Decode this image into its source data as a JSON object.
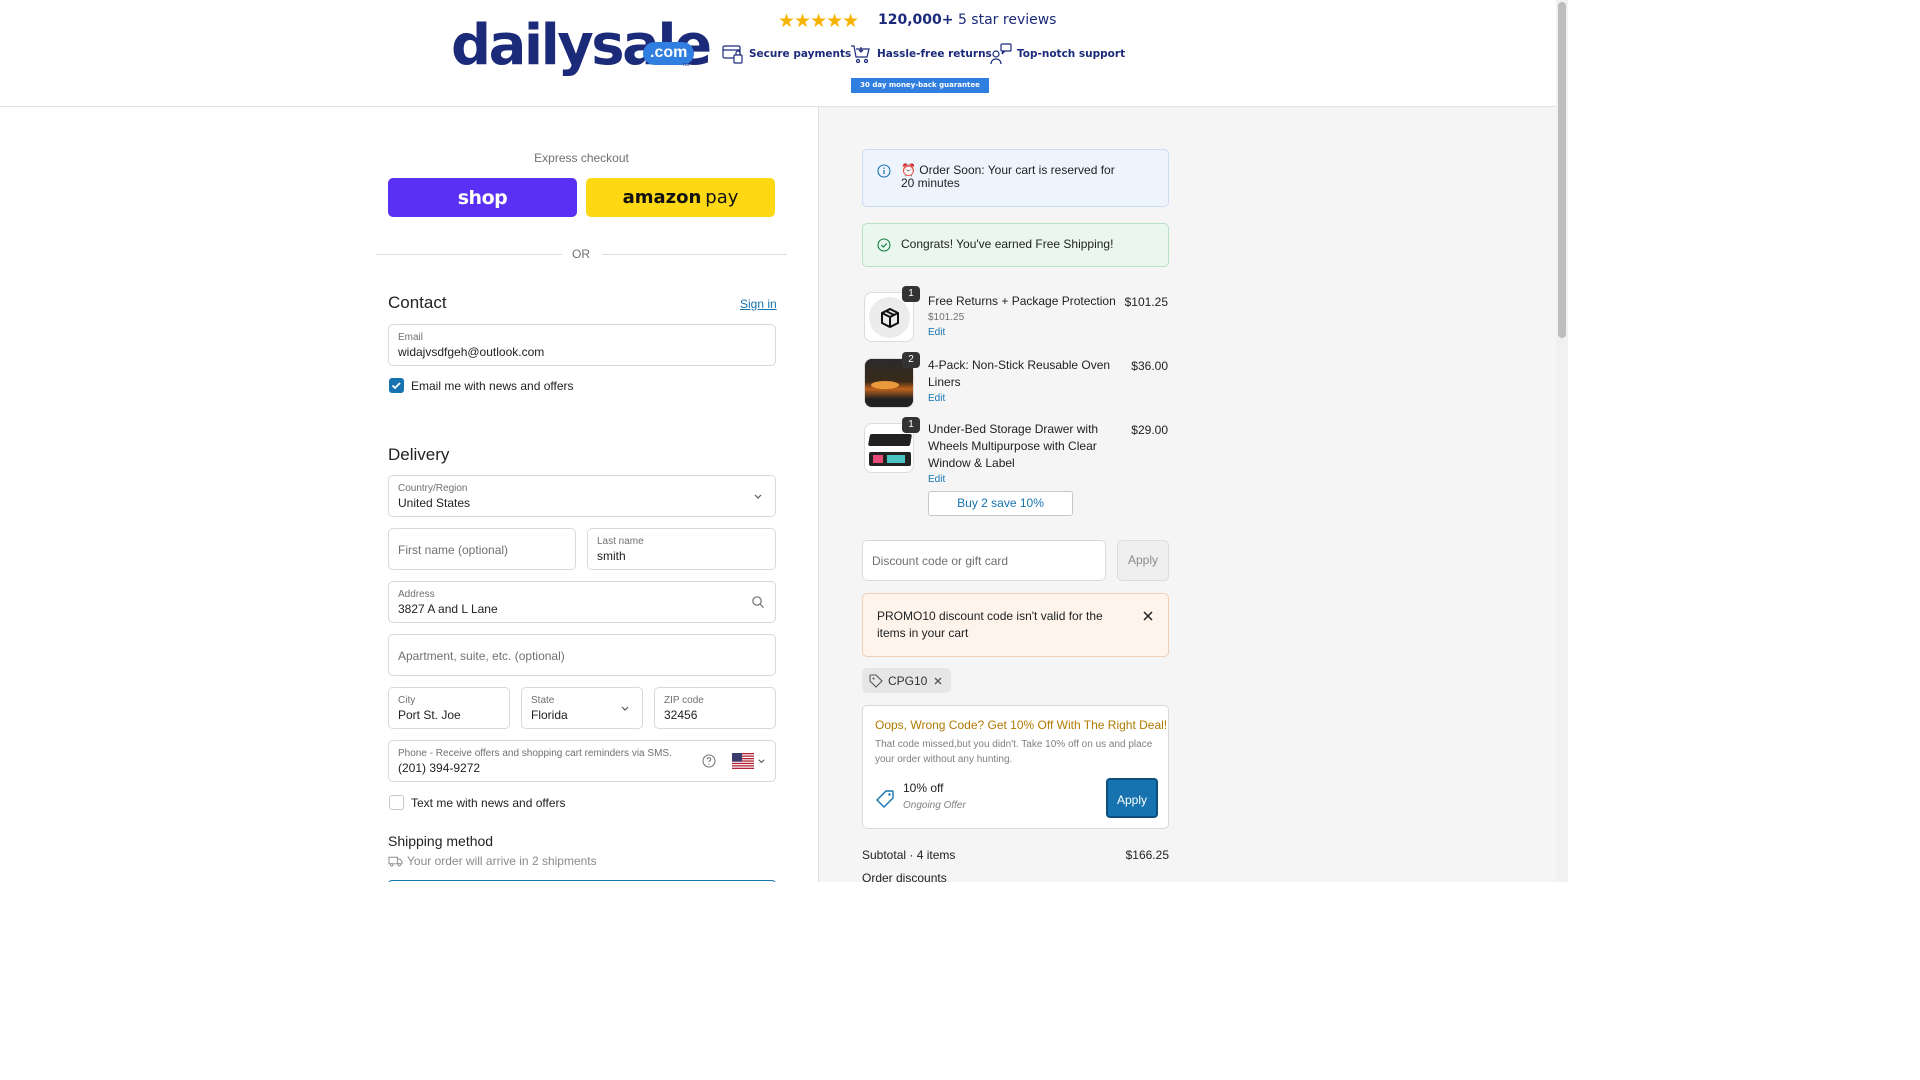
{
  "header": {
    "logo_text": "dailysale",
    "logo_suffix": ".com",
    "logo_tm": "™",
    "stars": "★★★★★",
    "reviews_count": "120,000+",
    "reviews_label": " 5 star reviews",
    "features": [
      {
        "label": "Secure payments",
        "icon": "secure-payment-icon"
      },
      {
        "label": "Hassle-free returns",
        "icon": "cart-return-icon"
      },
      {
        "label": "Top-notch support",
        "icon": "support-agent-icon"
      }
    ],
    "guarantee": "30 day money-back guarantee"
  },
  "express": {
    "label": "Express checkout",
    "shop_label": "shop",
    "amazon_label": "amazon",
    "amazon_pay": "pay",
    "or": "OR"
  },
  "contact": {
    "title": "Contact",
    "sign_in": "Sign in",
    "email_label": "Email",
    "email_value": "widajvsdfgeh@outlook.com",
    "news_checkbox": "Email me with news and offers",
    "news_checked": true
  },
  "delivery": {
    "title": "Delivery",
    "country_label": "Country/Region",
    "country_value": "United States",
    "first_name_placeholder": "First name (optional)",
    "last_name_label": "Last name",
    "last_name_value": "smith",
    "address_label": "Address",
    "address_value": "3827 A and L Lane",
    "apartment_placeholder": "Apartment, suite, etc. (optional)",
    "city_label": "City",
    "city_value": "Port St. Joe",
    "state_label": "State",
    "state_value": "Florida",
    "zip_label": "ZIP code",
    "zip_value": "32456",
    "phone_label": "Phone - Receive offers and shopping cart reminders via SMS.",
    "phone_value": "(201) 394-9272",
    "sms_checkbox": "Text me with news and offers",
    "sms_checked": false
  },
  "shipping": {
    "title": "Shipping method",
    "note": "Your order will arrive in 2 shipments"
  },
  "cart": {
    "reserve_notice": "⏰ Order Soon: Your cart is reserved for 20 minutes",
    "reserve_line1": "⏰ Order Soon: Your cart is reserved for",
    "reserve_line2": "20 minutes",
    "free_shipping_notice": "Congrats! You've earned Free Shipping!",
    "items": [
      {
        "qty": "1",
        "name": "Free Returns + Package Protection",
        "sub": "$101.25",
        "edit": "Edit",
        "price": "$101.25"
      },
      {
        "qty": "2",
        "name_line1": "4-Pack: Non-Stick Reusable Oven",
        "name_line2": "Liners",
        "edit": "Edit",
        "price": "$36.00"
      },
      {
        "qty": "1",
        "name_line1": "Under-Bed Storage Drawer with",
        "name_line2": "Wheels Multipurpose with Clear",
        "name_line3": "Window & Label",
        "edit": "Edit",
        "price": "$29.00"
      }
    ],
    "buy2": "Buy 2 save 10%"
  },
  "discount": {
    "placeholder": "Discount code or gift card",
    "apply": "Apply",
    "error_line1": "PROMO10 discount code isn't valid for the",
    "error_line2": "items in your cart",
    "applied_code": "CPG10"
  },
  "promo": {
    "title": "Oops, Wrong Code? Get 10% Off With The Right Deal!",
    "desc": "That code missed,but you didn't. Take 10% off on us and place your order without any hunting.",
    "offer": "10% off",
    "offer_sub": "Ongoing Offer",
    "apply": "Apply"
  },
  "summary": {
    "subtotal_label": "Subtotal · 4 items",
    "subtotal_value": "$166.25",
    "discounts_label": "Order discounts"
  },
  "colors": {
    "brand_navy": "#1c2a7a",
    "brand_blue": "#2f7ee0",
    "shop_purple": "#5a31f4",
    "amazon_yellow": "#fed813",
    "link_blue": "#1773b0"
  }
}
